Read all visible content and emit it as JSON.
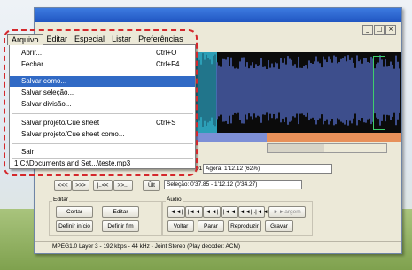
{
  "menubar": {
    "items": [
      "Arquivo",
      "Editar",
      "Especial",
      "Listar",
      "Preferências"
    ]
  },
  "window_controls": [
    "_",
    "□",
    "×"
  ],
  "file_menu": {
    "items": [
      {
        "label": "Abrir...",
        "shortcut": "Ctrl+O"
      },
      {
        "label": "Fechar",
        "shortcut": "Ctrl+F4"
      },
      {
        "label": "Salvar como...",
        "shortcut": ""
      },
      {
        "label": "Salvar seleção...",
        "shortcut": ""
      },
      {
        "label": "Salvar divisão...",
        "shortcut": ""
      },
      {
        "label": "Salvar projeto/Cue sheet",
        "shortcut": "Ctrl+S"
      },
      {
        "label": "Salvar projeto/Cue sheet como...",
        "shortcut": ""
      },
      {
        "label": "Sair",
        "shortcut": ""
      },
      {
        "label": "1 C:\\Documents and Set...\\teste.mp3",
        "shortcut": ""
      }
    ]
  },
  "position": {
    "time_text": "01",
    "agora_text": "Agora: 1'12.12  (62%)",
    "selection_text": "Seleção: 0'37.85 - 1'12.12 (0'34.27)"
  },
  "nav_buttons": [
    "<<<",
    ">>>",
    "|..<<",
    ">>..|",
    "Ûlt"
  ],
  "editar": {
    "label": "Editar",
    "buttons": [
      "Cortar",
      "Editar",
      "Definir início",
      "Definir fim"
    ]
  },
  "audio": {
    "label": "Áudio",
    "buttons": [
      "◄◄|",
      "|◄◄",
      "◄◄|",
      "|◄◄",
      "◄◄|..|◄◄",
      "►►argem"
    ],
    "buttons2": [
      "Voltar",
      "Parar",
      "Reproduzir",
      "Gravar"
    ]
  },
  "status": "MPEG1.0 Layer 3 - 192 kbps - 44 kHz - Joint Stereo    (Play decoder: ACM)"
}
